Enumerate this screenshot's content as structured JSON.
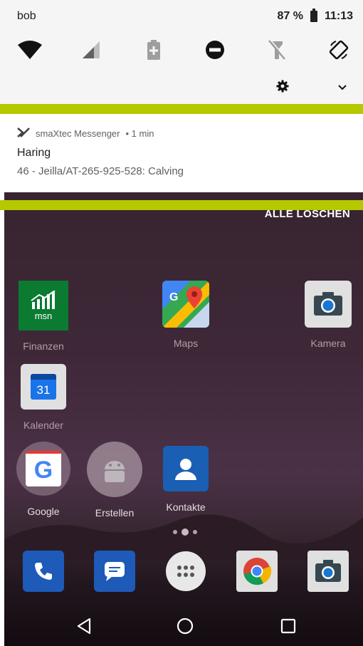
{
  "status_bar": {
    "user": "bob",
    "battery_percent": "87 %",
    "time": "11:13"
  },
  "quick_tiles": [
    {
      "icon": "wifi-icon"
    },
    {
      "icon": "cellular-signal-icon"
    },
    {
      "icon": "battery-saver-icon"
    },
    {
      "icon": "do-not-disturb-icon"
    },
    {
      "icon": "flashlight-icon"
    },
    {
      "icon": "auto-rotate-icon"
    }
  ],
  "notification": {
    "app_name": "smaXtec Messenger",
    "time_ago": "• 1 min",
    "title": "Haring",
    "text": "46 - Jeilla/AT-265-925-528: Calving"
  },
  "clear_all_label": "ALLE LÖSCHEN",
  "home_apps": [
    {
      "label": "Finanzen",
      "icon": "msn-finance-icon",
      "icon_text": "msn"
    },
    {
      "label": "Maps",
      "icon": "maps-icon"
    },
    {
      "label": "Kamera",
      "icon": "camera-icon"
    },
    {
      "label": "Kalender",
      "icon": "calendar-icon",
      "icon_text": "31"
    },
    {
      "label": "Google",
      "icon": "google-icon",
      "icon_text": "G"
    },
    {
      "label": "Erstellen",
      "icon": "android-icon"
    },
    {
      "label": "Kontakte",
      "icon": "contacts-icon"
    }
  ],
  "dock_apps": [
    {
      "icon": "phone-icon"
    },
    {
      "icon": "messages-icon"
    },
    {
      "icon": "app-drawer-icon"
    },
    {
      "icon": "chrome-icon"
    },
    {
      "icon": "camera-icon"
    }
  ],
  "colors": {
    "accent_bar": "#b5c900",
    "quick_settings_bg": "#f5f5f5"
  }
}
